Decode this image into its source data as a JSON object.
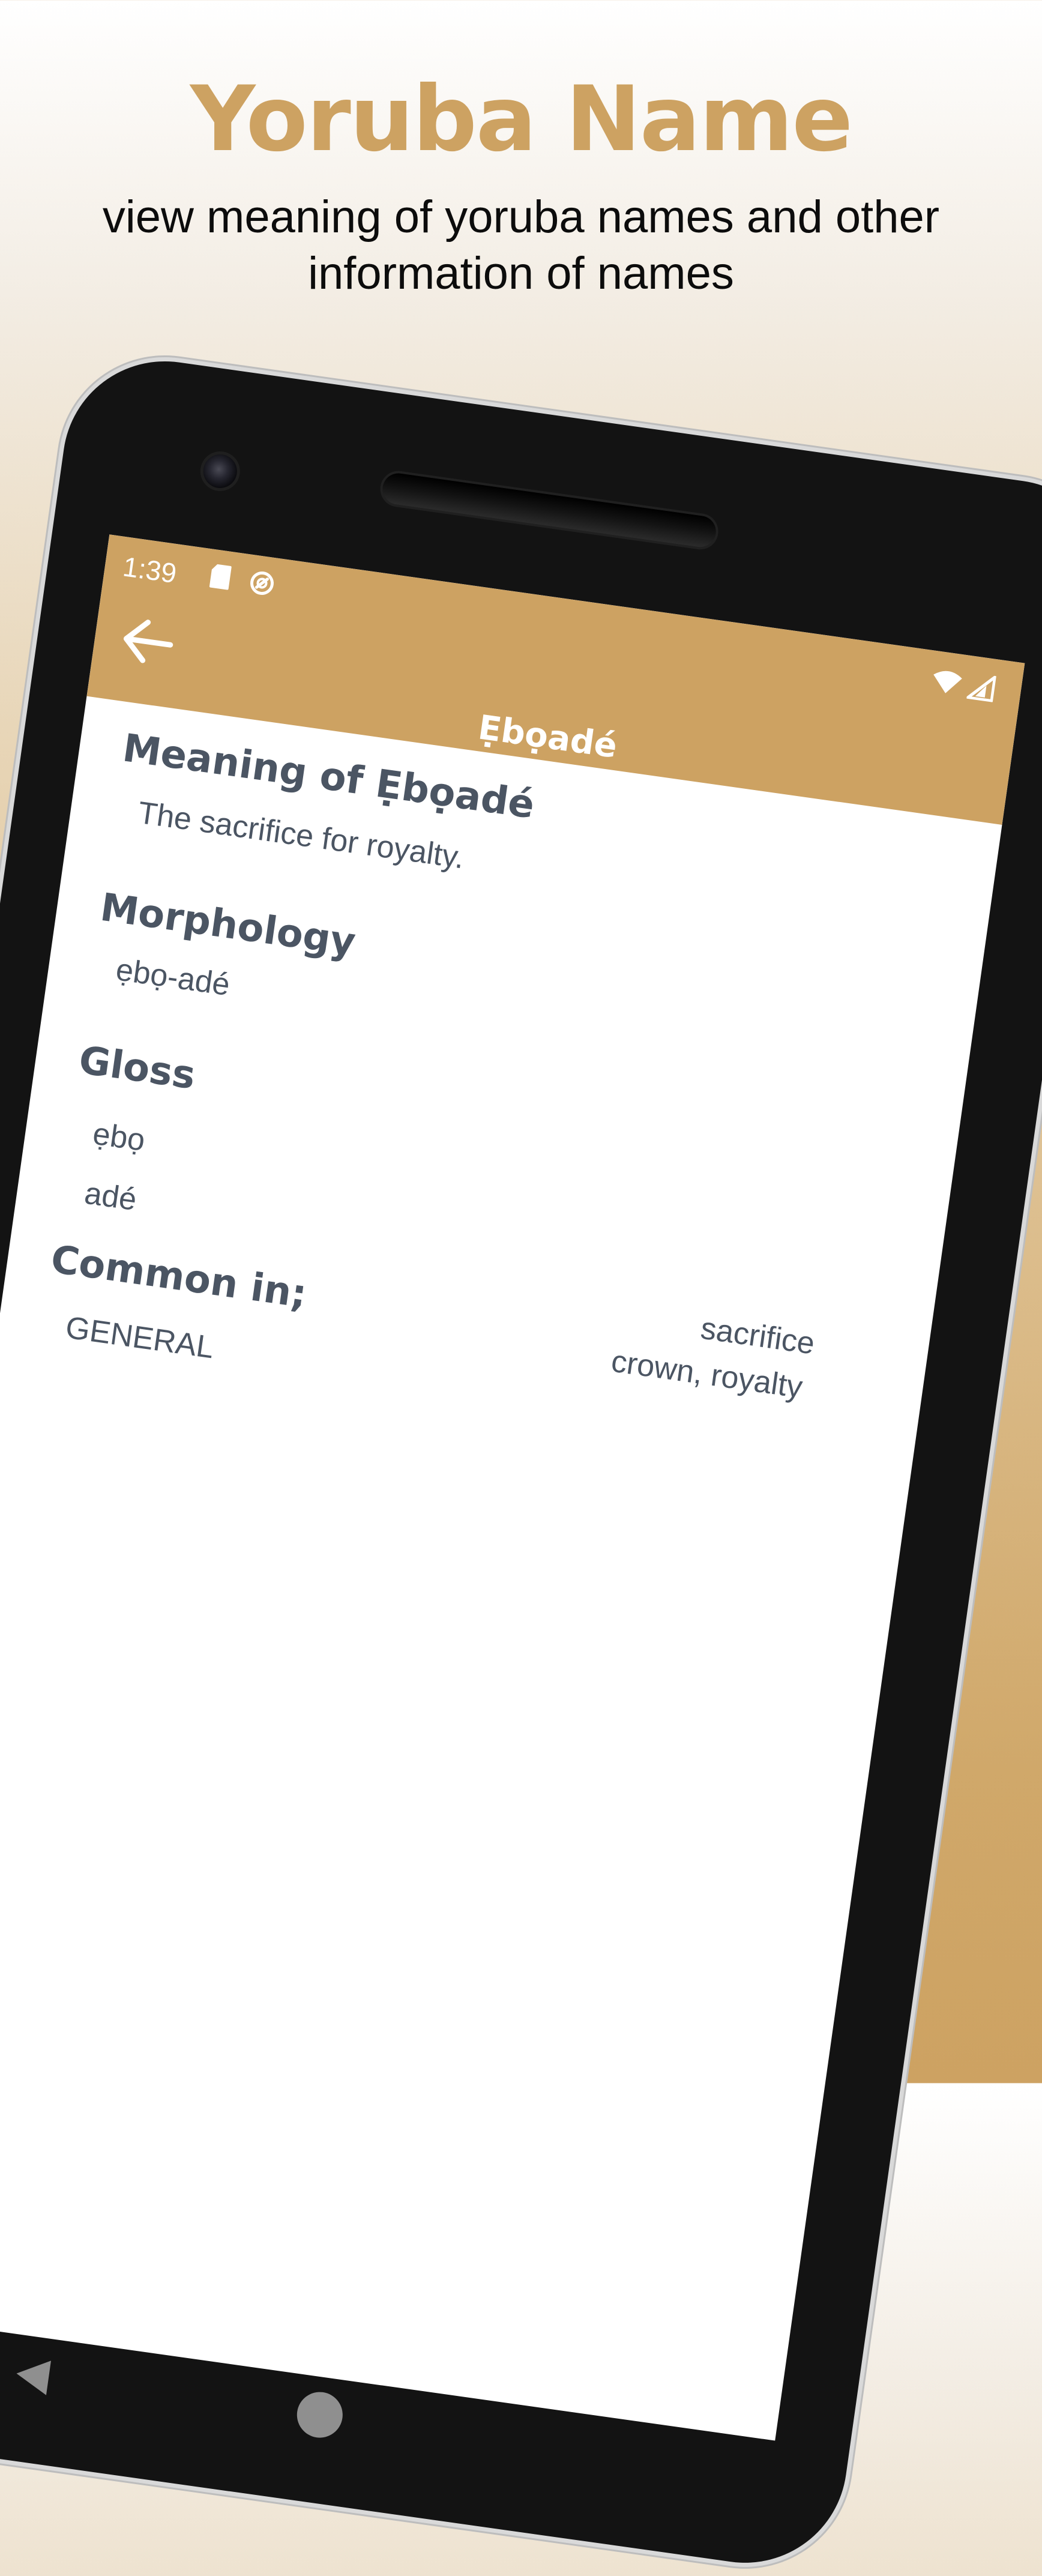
{
  "promo": {
    "title": "Yoruba Name",
    "subtitle": "view meaning of yoruba names and other information of names"
  },
  "status_bar": {
    "time": "1:39",
    "icons": [
      "sd-card-icon",
      "sync-icon",
      "wifi-icon",
      "signal-icon"
    ]
  },
  "app_bar": {
    "back_icon": "back-arrow-icon",
    "title": "Ẹbọadé"
  },
  "sections": {
    "meaning": {
      "title": "Meaning of Ẹbọadé",
      "text": "The sacrifice for royalty."
    },
    "morphology": {
      "title": "Morphology",
      "text": "ẹbọ-adé"
    },
    "gloss": {
      "title": "Gloss",
      "rows": [
        {
          "term": "ẹbọ",
          "meaning": "sacrifice"
        },
        {
          "term": "adé",
          "meaning": "crown, royalty"
        }
      ]
    },
    "common_in": {
      "title": "Common in;",
      "text": "GENERAL"
    }
  },
  "nav_bar": {
    "icons": [
      "nav-back-icon",
      "nav-home-icon"
    ]
  },
  "colors": {
    "accent": "#cda262",
    "text": "#4b5563",
    "app_bar_text": "#ffffff"
  }
}
